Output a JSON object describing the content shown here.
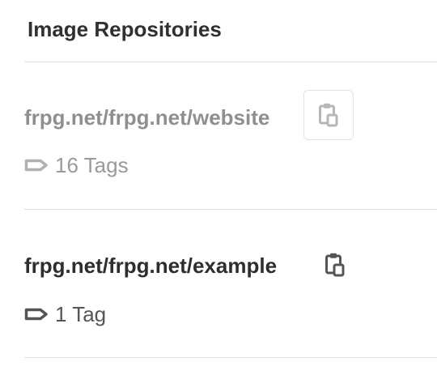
{
  "panel": {
    "title": "Image Repositories"
  },
  "repositories": [
    {
      "name": "frpg.net/frpg.net/website",
      "tag_count_label": "16 Tags",
      "tag_icon": "label-icon",
      "copy_icon": "clipboard-icon",
      "colors": {
        "text": "#8f8f8f"
      }
    },
    {
      "name": "frpg.net/frpg.net/example",
      "tag_count_label": "1 Tag",
      "tag_icon": "label-icon",
      "copy_icon": "clipboard-icon",
      "colors": {
        "text": "#2e2e2e"
      }
    }
  ]
}
